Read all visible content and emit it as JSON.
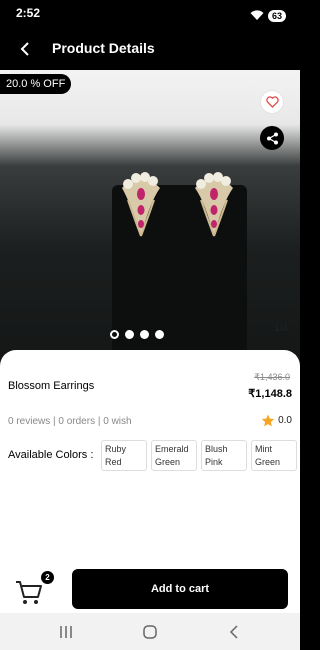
{
  "status_bar": {
    "time": "2:52",
    "battery": "63"
  },
  "app_bar": {
    "title": "Product Details"
  },
  "gallery": {
    "discount": "20.0 % OFF",
    "counter": "1/4",
    "image_count": 4,
    "active_index": 0
  },
  "product": {
    "name": "Blossom Earrings",
    "price_old": "₹1,436.0",
    "price_new": "₹1,148.8",
    "meta": "0 reviews | 0 orders | 0 wish",
    "rating": "0.0",
    "colors_label": "Available Colors :",
    "colors": [
      "Ruby Red",
      "Emerald Green",
      "Blush Pink",
      "Mint Green"
    ]
  },
  "cart": {
    "count": "2",
    "add_label": "Add to cart"
  },
  "theme": {
    "accent": "#000000",
    "star": "#f5a623",
    "heart": "#e04a4a"
  }
}
